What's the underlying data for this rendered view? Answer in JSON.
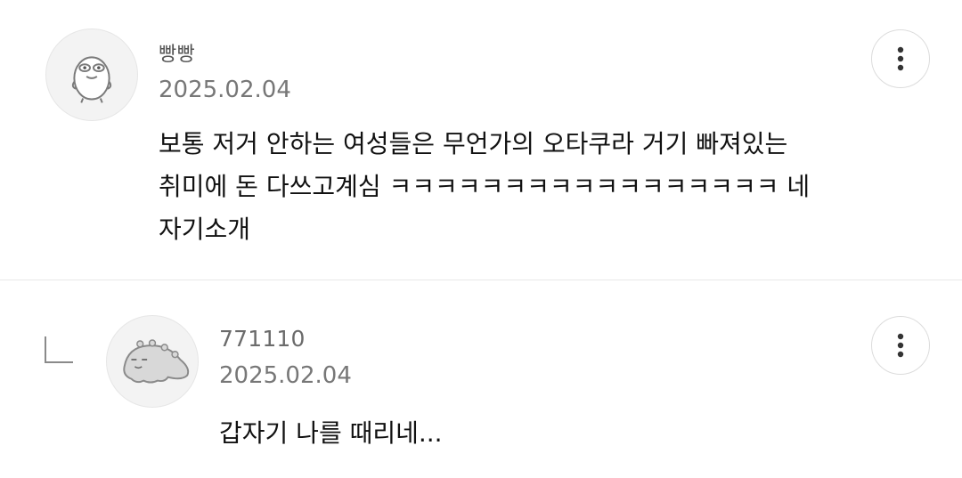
{
  "comments": [
    {
      "author": "빵빵",
      "date": "2025.02.04",
      "lines": [
        "보통 저거 안하는 여성들은 무언가의 오타쿠라 거기 빠져있는",
        "취미에 돈 다쓰고계심 ㅋㅋㅋㅋㅋㅋㅋㅋㅋㅋㅋㅋㅋㅋㅋㅋㅋ 네",
        "자기소개"
      ],
      "avatar_icon": "character-avatar-icon",
      "more_icon": "more-vertical-icon"
    },
    {
      "author": "771110",
      "date": "2025.02.04",
      "lines": [
        "갑자기 나를 때리네..."
      ],
      "is_reply": true,
      "reply_icon": "reply-indent-icon",
      "avatar_icon": "creature-avatar-icon",
      "more_icon": "more-vertical-icon"
    }
  ],
  "colors": {
    "background": "#ffffff",
    "divider": "#e8e8e8",
    "meta_text": "#777777",
    "body_text": "#111111"
  }
}
